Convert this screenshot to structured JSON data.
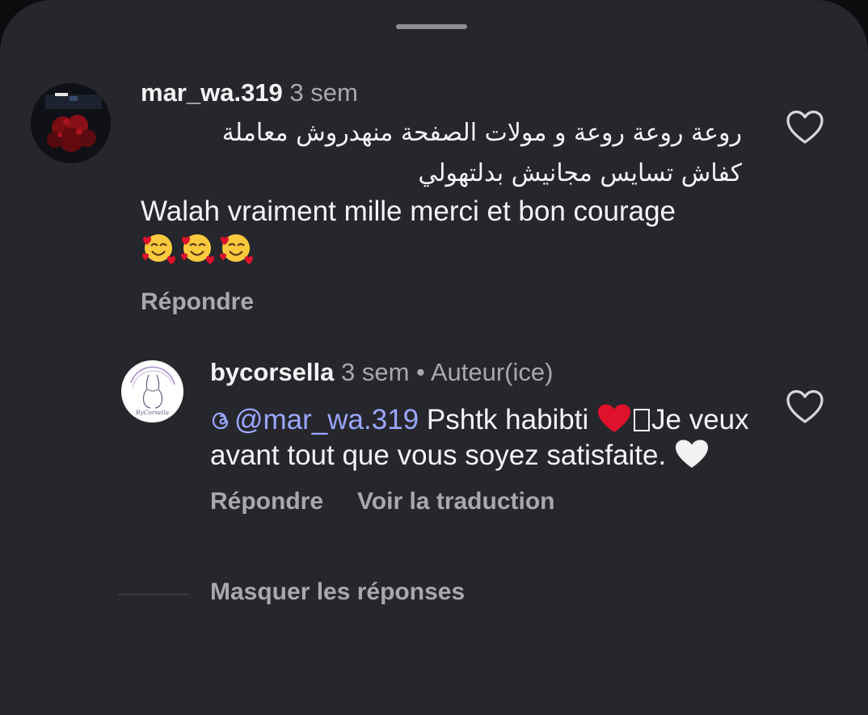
{
  "sheet": {
    "background": "#26272c",
    "handle_color": "#8e8e93"
  },
  "comment": {
    "username": "mar_wa.319",
    "time": "3 sem",
    "text_rtl_line1": "روعة روعة روعة و مولات الصفحة منهدروش معاملة",
    "text_rtl_line2": "كفاش تسايس مجانيش بدلتهولي",
    "text_fr": "Walah vraiment mille merci et bon courage",
    "emojis": [
      "smiling-face-with-hearts",
      "smiling-face-with-hearts",
      "smiling-face-with-hearts"
    ],
    "reply_label": "Répondre",
    "like_icon": "heart-outline-icon"
  },
  "reply": {
    "username": "bycorsella",
    "time": "3 sem",
    "separator": "•",
    "author_tag": "Auteur(ice)",
    "avatar_text": "ByCorsella",
    "mention": "@mar_wa.319",
    "text_part1": "Pshtk habibti",
    "text_part2": "Je veux avant tout que vous soyez satisfaite.",
    "reply_label": "Répondre",
    "translate_label": "Voir la traduction",
    "like_icon": "heart-outline-icon"
  },
  "hide_replies_label": "Masquer les réponses",
  "colors": {
    "primary_text": "#f4f4f5",
    "secondary_text": "#a8a8ad",
    "mention": "#9aa6ff",
    "red_heart": "#e0112b"
  }
}
